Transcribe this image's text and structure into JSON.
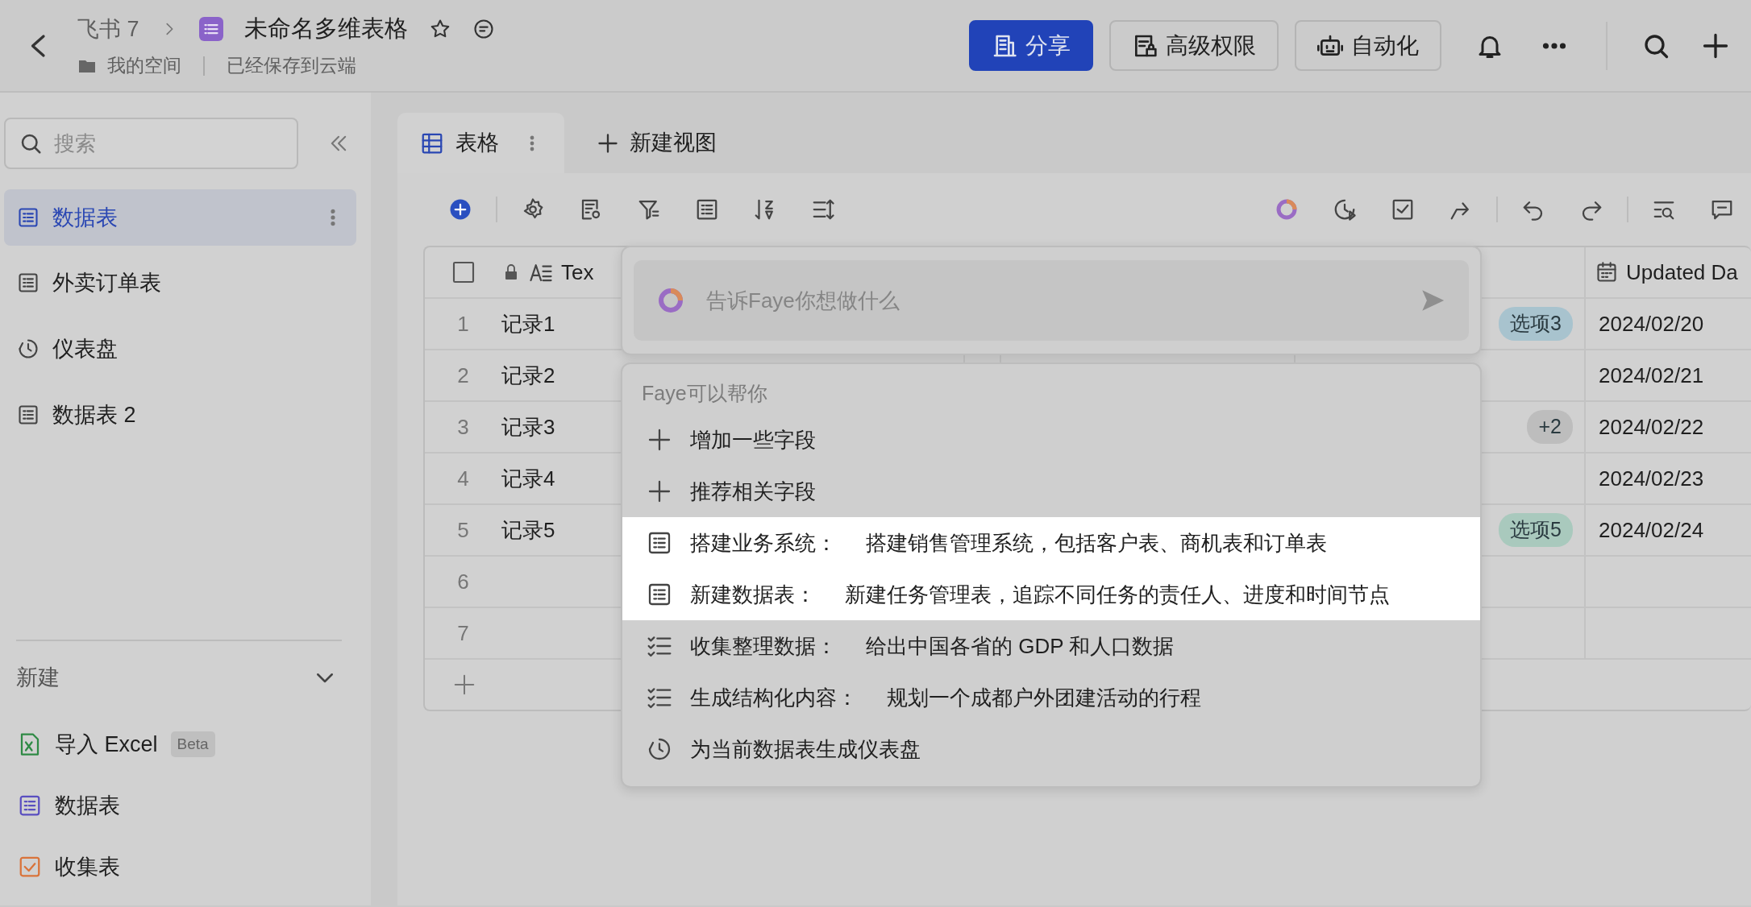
{
  "topbar": {
    "breadcrumb": "飞书 7",
    "title": "未命名多维表格",
    "location": "我的空间",
    "save_status": "已经保存到云端",
    "buttons": [
      {
        "label": "分享",
        "kind": "building",
        "primary": true
      },
      {
        "label": "高级权限",
        "kind": "permission",
        "primary": false
      },
      {
        "label": "自动化",
        "kind": "robot",
        "primary": false
      }
    ]
  },
  "sidebar": {
    "search": {
      "placeholder": "搜索"
    },
    "items": [
      {
        "label": "数据表",
        "kind": "table",
        "selected": true
      },
      {
        "label": "外卖订单表",
        "kind": "table",
        "selected": false
      },
      {
        "label": "仪表盘",
        "kind": "dashboard",
        "selected": false
      },
      {
        "label": "数据表 2",
        "kind": "table",
        "selected": false
      }
    ],
    "new_section": {
      "title": "新建",
      "expanded": true,
      "items": [
        {
          "label": "导入 Excel",
          "kind": "excel",
          "badge": "Beta"
        },
        {
          "label": "数据表",
          "kind": "table"
        },
        {
          "label": "收集表",
          "kind": "form"
        }
      ]
    }
  },
  "view_tabs": [
    {
      "label": "表格",
      "selected": true
    }
  ],
  "new_view": "新建视图",
  "table": {
    "columns": {
      "column_1": "Tex",
      "column_2": "Updated Da"
    },
    "rows": [
      {
        "number": "1",
        "name": "记录1",
        "tag": {
          "text": "选项3",
          "color": "#a8c3ce"
        },
        "date": "2024/02/20"
      },
      {
        "number": "2",
        "name": "记录2",
        "date": "2024/02/21"
      },
      {
        "number": "3",
        "name": "记录3",
        "tag": {
          "text": "+2",
          "color": "#bdbdbd"
        },
        "date": "2024/02/22"
      },
      {
        "number": "4",
        "name": "记录4",
        "date": "2024/02/23"
      },
      {
        "number": "5",
        "name": "记录5",
        "tag": {
          "text": "选项5",
          "color": "#a9c9bd"
        },
        "date": "2024/02/24"
      },
      {
        "number": "6"
      },
      {
        "number": "7"
      }
    ]
  },
  "assistant": {
    "placeholder": "告诉Faye你想做什么",
    "menu_title": "Faye可以帮你",
    "items": [
      {
        "kind": "plus",
        "label": "增加一些字段",
        "highlighted": false
      },
      {
        "kind": "plus",
        "label": "推荐相关字段",
        "highlighted": false
      },
      {
        "kind": "table",
        "label": "搭建业务系统：",
        "detail": "搭建销售管理系统，包括客户表、商机表和订单表",
        "highlighted": true
      },
      {
        "kind": "table",
        "label": "新建数据表：",
        "detail": "新建任务管理表，追踪不同任务的责任人、进度和时间节点",
        "highlighted": true
      },
      {
        "kind": "checklist",
        "label": "收集整理数据：",
        "detail": "给出中国各省的 GDP 和人口数据",
        "highlighted": false
      },
      {
        "kind": "checklist",
        "label": "生成结构化内容：",
        "detail": "规划一个成都户外团建活动的行程",
        "highlighted": false
      },
      {
        "kind": "dashboard",
        "label": "为当前数据表生成仪表盘",
        "highlighted": false
      }
    ]
  }
}
